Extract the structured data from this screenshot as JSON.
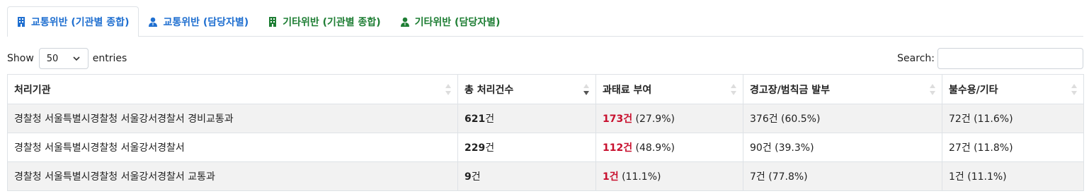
{
  "tabs": [
    {
      "label": "교통위반 (기관별 종합)",
      "icon": "building-icon",
      "color": "#1f6fd0",
      "active": true
    },
    {
      "label": "교통위반 (담당자별)",
      "icon": "person-icon",
      "color": "#1f6fd0",
      "active": false
    },
    {
      "label": "기타위반 (기관별 종합)",
      "icon": "building-icon",
      "color": "#1e7e34",
      "active": false
    },
    {
      "label": "기타위반 (담당자별)",
      "icon": "person-icon",
      "color": "#1e7e34",
      "active": false
    }
  ],
  "length": {
    "prefix": "Show",
    "value": "50",
    "suffix": "entries"
  },
  "search": {
    "label": "Search:",
    "value": ""
  },
  "table": {
    "headers": [
      "처리기관",
      "총 처리건수",
      "과태료 부여",
      "경고장/범칙금 발부",
      "불수용/기타"
    ],
    "sorted_column": "총 처리건수",
    "sort_direction": "desc",
    "rows": [
      {
        "agency": "경찰청 서울특별시경찰청 서울강서경찰서 경비교통과",
        "total_num": "621",
        "total_unit": "건",
        "fine_num": "173건",
        "fine_pct": " (27.9%)",
        "warning": "376건 (60.5%)",
        "rejected": "72건 (11.6%)"
      },
      {
        "agency": "경찰청 서울특별시경찰청 서울강서경찰서",
        "total_num": "229",
        "total_unit": "건",
        "fine_num": "112건",
        "fine_pct": " (48.9%)",
        "warning": "90건 (39.3%)",
        "rejected": "27건 (11.8%)"
      },
      {
        "agency": "경찰청 서울특별시경찰청 서울강서경찰서 교통과",
        "total_num": "9",
        "total_unit": "건",
        "fine_num": "1건",
        "fine_pct": " (11.1%)",
        "warning": "7건 (77.8%)",
        "rejected": "1건 (11.1%)"
      }
    ]
  },
  "colors": {
    "fine": "#c8102e",
    "tab_blue": "#1f6fd0",
    "tab_green": "#1e7e34",
    "stripe": "#f2f2f2"
  }
}
